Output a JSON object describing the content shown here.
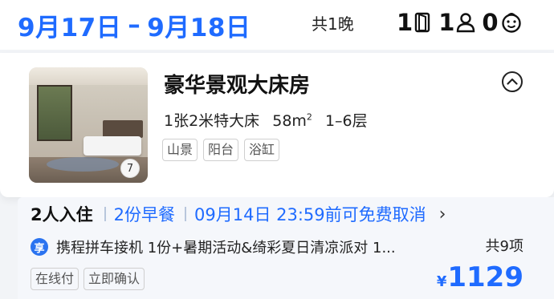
{
  "header": {
    "date_start": "9月17日",
    "separator": "–",
    "date_end": "9月18日",
    "nights": "共1晚",
    "rooms_count": "1",
    "adults_count": "1",
    "children_count": "0",
    "icons": [
      "door-icon",
      "adult-icon",
      "child-icon"
    ],
    "accent_color": "#1f6bff"
  },
  "room": {
    "name": "豪华景观大床房",
    "bed": "1张2米特大床",
    "area": "58m",
    "area_sup": "2",
    "floors": "1–6层",
    "photo_count": "7",
    "tags": [
      "山景",
      "阳台",
      "浴缸"
    ]
  },
  "rate": {
    "persons": "2人入住",
    "breakfast": "2份早餐",
    "cancel_policy": "09月14日 23:59前可免费取消",
    "badge": "享",
    "promo_text": "携程拼车接机 1份+暑期活动&绮彩夏日清凉派对 1...",
    "promo_total": "共9项",
    "tags": [
      "在线付",
      "立即确认"
    ],
    "currency": "¥",
    "price": "1129"
  }
}
